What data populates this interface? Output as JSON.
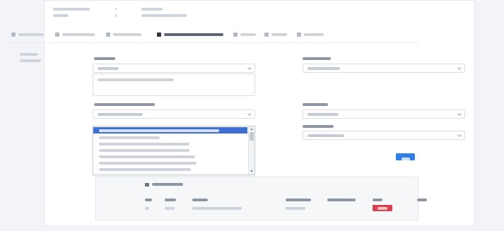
{
  "header": {
    "rows": [
      {
        "label": "",
        "value": ""
      },
      {
        "label": "",
        "value": ""
      }
    ]
  },
  "tabs": [
    {
      "label": "",
      "icon": "user-icon",
      "active": false
    },
    {
      "label": "",
      "icon": "document-icon",
      "active": false
    },
    {
      "label": "",
      "icon": "wrench-icon",
      "active": false
    },
    {
      "label": "",
      "icon": "list-icon",
      "active": true
    },
    {
      "label": "",
      "icon": "gear-icon",
      "active": false
    },
    {
      "label": "",
      "icon": "clipboard-icon",
      "active": false
    },
    {
      "label": "",
      "icon": "check-icon",
      "active": false
    }
  ],
  "side_nav": [
    {
      "label": ""
    },
    {
      "label": ""
    }
  ],
  "form": {
    "field1": {
      "label": "",
      "value": ""
    },
    "field1_notes": {
      "value": ""
    },
    "field2": {
      "label": "",
      "value": ""
    },
    "field3": {
      "label": "",
      "value": ""
    },
    "field4": {
      "label": "",
      "value": ""
    },
    "field5": {
      "label": "",
      "value": ""
    },
    "save_label": ""
  },
  "dropdown": {
    "options": [
      {
        "label": "",
        "selected": true
      },
      {
        "label": "",
        "selected": false
      },
      {
        "label": "",
        "selected": false
      },
      {
        "label": "",
        "selected": false
      },
      {
        "label": "",
        "selected": false
      },
      {
        "label": "",
        "selected": false
      },
      {
        "label": "",
        "selected": false
      }
    ]
  },
  "table": {
    "title": "",
    "title_icon": "list-icon",
    "columns": [
      "",
      "",
      "",
      "",
      "",
      "",
      ""
    ],
    "rows": [
      {
        "cells": [
          "",
          "",
          "",
          "",
          "",
          ""
        ],
        "action": ""
      }
    ]
  },
  "colors": {
    "accent": "#2f7fe6",
    "selected_option": "#3f6fd0",
    "danger": "#d9434f"
  }
}
